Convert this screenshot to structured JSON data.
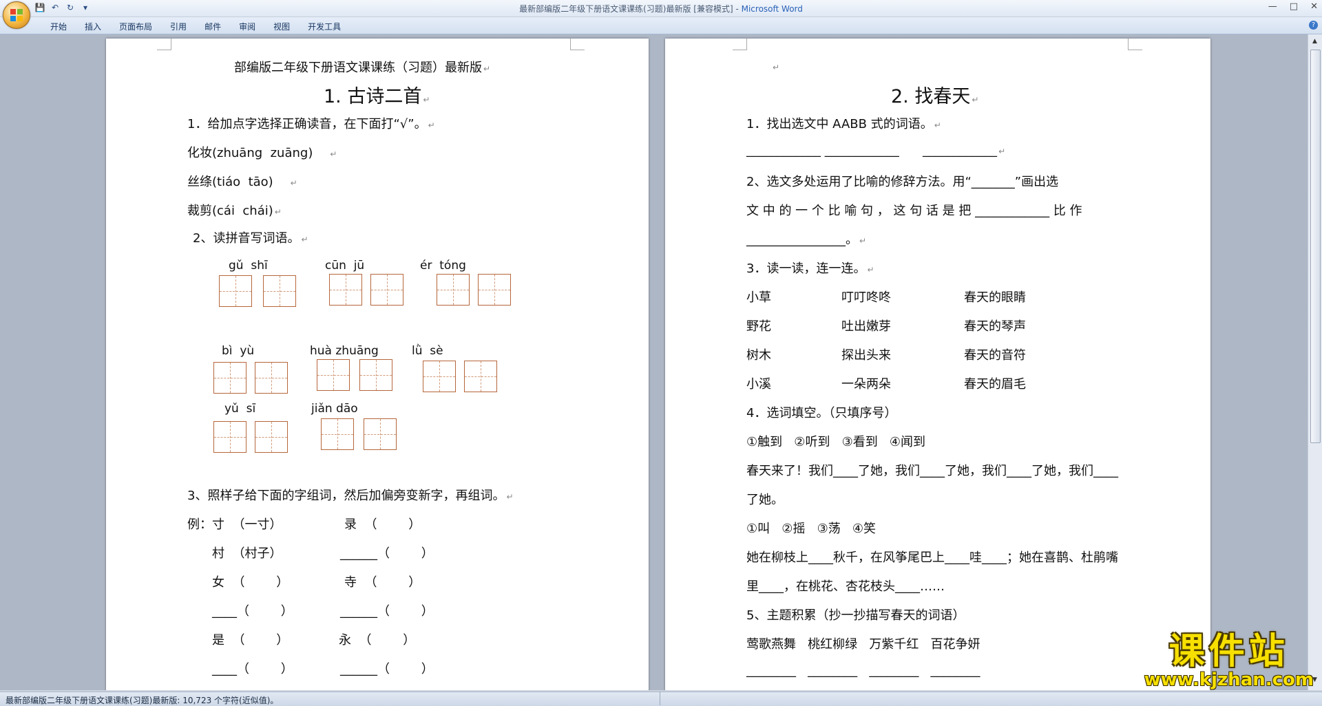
{
  "window": {
    "title": "最新部编版二年级下册语文课课练(习题)最新版 [兼容模式]",
    "app": "Microsoft Word",
    "controls": [
      "—",
      "□",
      "✕"
    ]
  },
  "ribbon": {
    "tabs": [
      "开始",
      "插入",
      "页面布局",
      "引用",
      "邮件",
      "审阅",
      "视图",
      "开发工具"
    ]
  },
  "page_left": {
    "header": "部编版二年级下册语文课课练（习题）最新版",
    "title": "1. 古诗二首",
    "q1": "1．给加点字选择正确读音，在下面打“√”。",
    "q1_items": [
      "化妆(zhuāng  zuāng)",
      "丝绦(tiáo  tāo)",
      "裁剪(cái  chái)"
    ],
    "q2": "2、读拼音写词语。",
    "pinyin": [
      "gǔ  shī",
      "cūn  jū",
      "ér  tóng",
      "bì  yù",
      "huà zhuāng",
      "lǜ  sè",
      "yǔ  sī",
      "jiǎn dāo"
    ],
    "q3": "3、照样子给下面的字组词，然后加偏旁变新字，再组词。",
    "q3_rows": [
      [
        "例：寸  （一寸）",
        "录  （        ）"
      ],
      [
        "村  （村子）",
        "______（        ）"
      ],
      [
        "女  （        ）",
        "寺  （        ）"
      ],
      [
        "____（        ）",
        "______（        ）"
      ],
      [
        "是  （        ）",
        "永  （        ）"
      ],
      [
        "____（        ）",
        "______（        ）"
      ]
    ]
  },
  "page_right": {
    "title": "2. 找春天",
    "q1": "1．找出选文中 AABB 式的词语。",
    "q1_blanks": "____________ ____________      ____________",
    "q2_line1": "2、选文多处运用了比喻的修辞方法。用“_______”画出选",
    "q2_line2": "文 中 的 一 个 比 喻 句 ， 这 句 话 是 把 ____________ 比 作",
    "q2_line3": "________________。",
    "q3": "3．读一读，连一连。",
    "match": [
      [
        "小草",
        "叮叮咚咚",
        "春天的眼睛"
      ],
      [
        "野花",
        "吐出嫩芽",
        "春天的琴声"
      ],
      [
        "树木",
        "探出头来",
        "春天的音符"
      ],
      [
        "小溪",
        "一朵两朵",
        "春天的眉毛"
      ]
    ],
    "q4": "4．选词填空。（只填序号）",
    "q4_opts1": "①触到   ②听到   ③看到   ④闻到",
    "q4_line1": "春天来了！我们____了她，我们____了她，我们____了她，我们____",
    "q4_line2": "了她。",
    "q4_opts2": "①叫   ②摇   ③荡   ④笑",
    "q4_line3": "她在柳枝上____秋千，在风筝尾巴上____哇____；她在喜鹊、杜鹃嘴",
    "q4_line4": "里____，在桃花、杏花枝头____……",
    "q5": "5、主题积累（抄一抄描写春天的词语）",
    "q5_words": "莺歌燕舞   桃红柳绿   万紫千红   百花争妍",
    "q5_blanks": "________   ________   ________   ________"
  },
  "status": {
    "text": "最新部编版二年级下册语文课课练(习题)最新版: 10,723 个字符(近似值)。"
  },
  "watermark": {
    "name": "课件站",
    "url": "www.kjzhan.com"
  }
}
